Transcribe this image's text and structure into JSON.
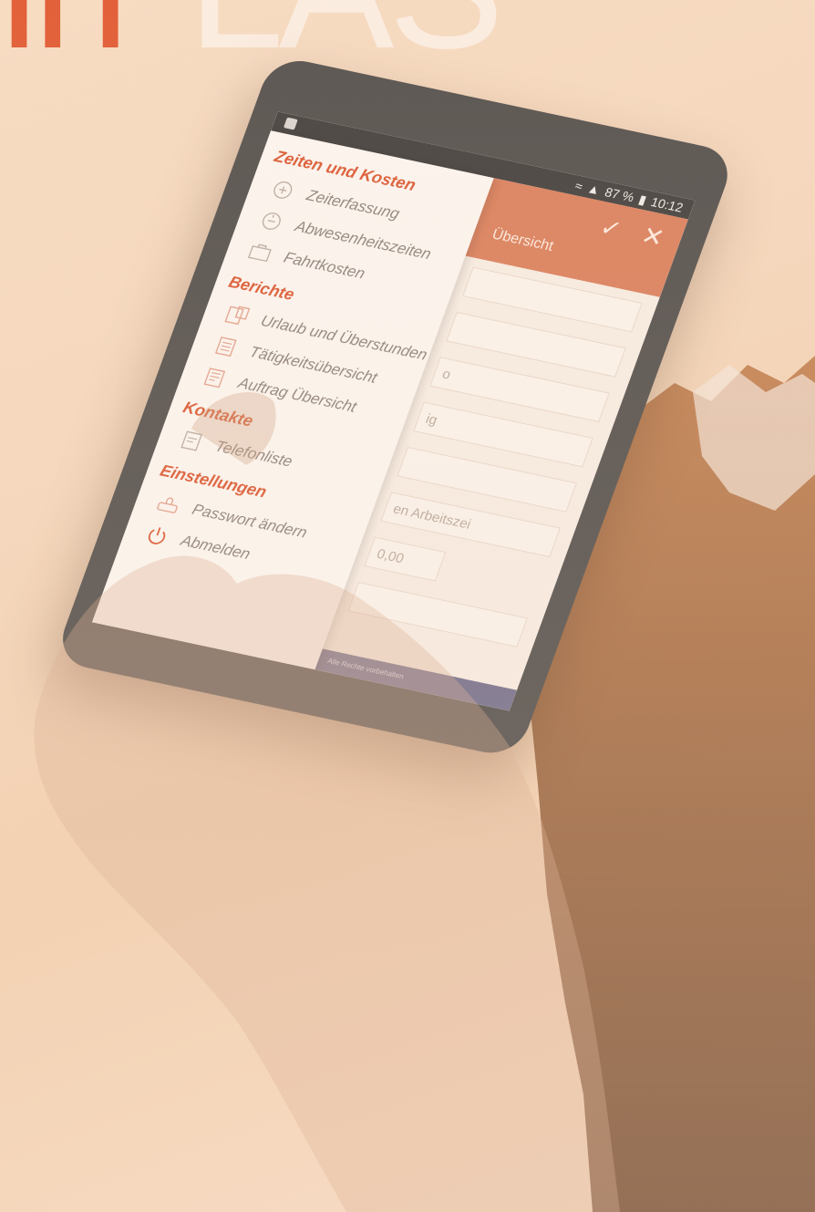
{
  "headline": {
    "part_a": "in",
    "part_b": "LAS"
  },
  "statusbar": {
    "battery": "87 %",
    "time": "10:12"
  },
  "appbar": {
    "title": "Übersicht",
    "confirm_icon": "check-icon",
    "close_icon": "close-icon"
  },
  "form": {
    "fields": [
      "",
      "",
      "o",
      "ig",
      "",
      "en Arbeitszei",
      "0,00",
      ""
    ],
    "footer": "Alle Rechte vorbehalten"
  },
  "drawer": {
    "sections": [
      {
        "title": "Zeiten und Kosten",
        "items": [
          {
            "label": "Zeiterfassung",
            "icon": "clock-plus-icon"
          },
          {
            "label": "Abwesenheitszeiten",
            "icon": "clock-minus-icon"
          },
          {
            "label": "Fahrtkosten",
            "icon": "briefcase-icon"
          }
        ]
      },
      {
        "title": "Berichte",
        "items": [
          {
            "label": "Urlaub und Überstunden",
            "icon": "report-calendar-icon"
          },
          {
            "label": "Tätigkeitsübersicht",
            "icon": "report-list-icon"
          },
          {
            "label": "Auftrag Übersicht",
            "icon": "report-order-icon"
          }
        ]
      },
      {
        "title": "Kontakte",
        "items": [
          {
            "label": "Telefonliste",
            "icon": "phone-list-icon"
          }
        ]
      },
      {
        "title": "Einstellungen",
        "items": [
          {
            "label": "Passwort ändern",
            "icon": "password-icon"
          },
          {
            "label": "Abmelden",
            "icon": "power-icon"
          }
        ]
      }
    ]
  },
  "colors": {
    "accent": "#d9542d",
    "appbar": "#d97c58",
    "headline": "#e0532b"
  }
}
